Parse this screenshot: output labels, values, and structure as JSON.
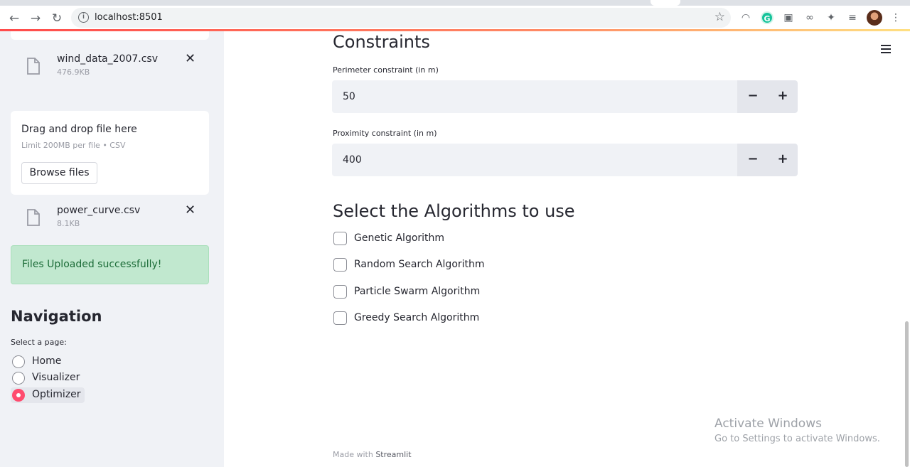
{
  "browser": {
    "url": "localhost:8501",
    "icons": [
      "back-icon",
      "forward-icon",
      "reload-icon",
      "info-icon",
      "star-icon",
      "extension-icon",
      "grammarly-icon",
      "puzzle-icon",
      "reading-list-icon",
      "profile-avatar",
      "more-icon"
    ]
  },
  "sidebar": {
    "files": [
      {
        "name": "wind_data_2007.csv",
        "size": "476.9KB"
      },
      {
        "name": "power_curve.csv",
        "size": "8.1KB"
      }
    ],
    "dropzone": {
      "title": "Drag and drop file here",
      "limit": "Limit 200MB per file • CSV",
      "browse_label": "Browse files"
    },
    "success_message": "Files Uploaded successfully!",
    "navigation": {
      "title": "Navigation",
      "label": "Select a page:",
      "options": [
        "Home",
        "Visualizer",
        "Optimizer"
      ],
      "selected": "Optimizer"
    }
  },
  "main": {
    "constraints_title": "Constraints",
    "perimeter": {
      "label": "Perimeter constraint (in m)",
      "value": "50"
    },
    "proximity": {
      "label": "Proximity constraint (in m)",
      "value": "400"
    },
    "stepper": {
      "minus": "−",
      "plus": "+"
    },
    "algorithms_title": "Select the Algorithms to use",
    "algorithms": [
      "Genetic Algorithm",
      "Random Search Algorithm",
      "Particle Swarm Algorithm",
      "Greedy Search Algorithm"
    ],
    "footer_prefix": "Made with",
    "footer_brand": "Streamlit"
  },
  "watermark": {
    "title": "Activate Windows",
    "subtitle": "Go to Settings to activate Windows."
  },
  "colors": {
    "accent": "#ff4b6e",
    "success_bg": "#c1e8cf",
    "sidebar_bg": "#f0f2f6"
  }
}
